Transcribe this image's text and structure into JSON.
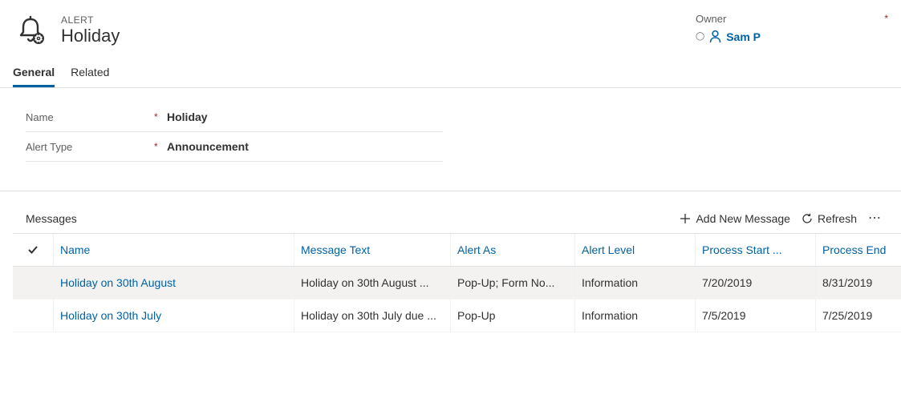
{
  "header": {
    "entity_type": "ALERT",
    "title": "Holiday",
    "owner_label": "Owner",
    "owner_value": "Sam P",
    "owner_required": "*"
  },
  "tabs": {
    "general": "General",
    "related": "Related"
  },
  "fields": {
    "name_label": "Name",
    "name_value": "Holiday",
    "alert_type_label": "Alert Type",
    "alert_type_value": "Announcement"
  },
  "messages": {
    "section_title": "Messages",
    "add_label": "Add New Message",
    "refresh_label": "Refresh",
    "columns": {
      "name": "Name",
      "message": "Message Text",
      "alert_as": "Alert As",
      "alert_level": "Alert Level",
      "start": "Process Start ...",
      "end": "Process End"
    },
    "rows": [
      {
        "name": "Holiday on 30th August",
        "message": "Holiday on 30th August ...",
        "alert_as": "Pop-Up; Form No...",
        "alert_level": "Information",
        "start": "7/20/2019",
        "end": "8/31/2019"
      },
      {
        "name": "Holiday on 30th July",
        "message": "Holiday on 30th July due ...",
        "alert_as": "Pop-Up",
        "alert_level": "Information",
        "start": "7/5/2019",
        "end": "7/25/2019"
      }
    ]
  }
}
